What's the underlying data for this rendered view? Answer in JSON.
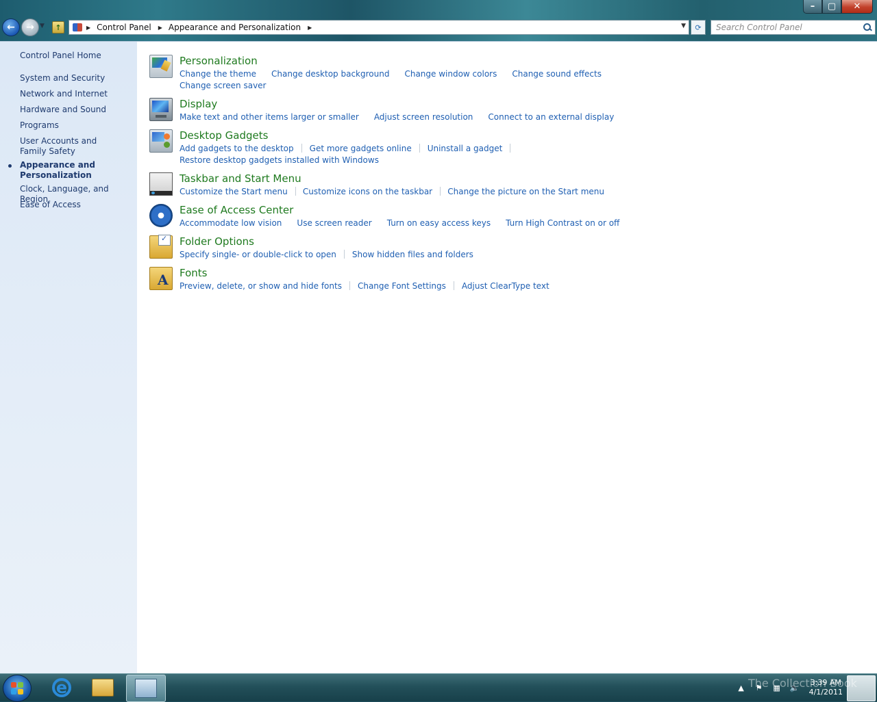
{
  "window": {
    "buttons": {
      "minimize": "–",
      "maximize": "▢",
      "close": "✕"
    }
  },
  "nav": {
    "back_glyph": "←",
    "forward_glyph": "→",
    "refresh_glyph": "⟳"
  },
  "address": {
    "crumbs": [
      "Control Panel",
      "Appearance and Personalization"
    ]
  },
  "search": {
    "placeholder": "Search Control Panel"
  },
  "sidebar": {
    "items": [
      {
        "label": "Control Panel Home"
      },
      {
        "label": "System and Security"
      },
      {
        "label": "Network and Internet"
      },
      {
        "label": "Hardware and Sound"
      },
      {
        "label": "Programs"
      },
      {
        "label": "User Accounts and Family Safety"
      },
      {
        "label": "Appearance and Personalization",
        "active": true
      },
      {
        "label": "Clock, Language, and Region"
      },
      {
        "label": "Ease of Access"
      }
    ]
  },
  "categories": [
    {
      "title": "Personalization",
      "icon": "personalization-icon",
      "lines": [
        [
          "Change the theme",
          "Change desktop background",
          "Change window colors",
          "Change sound effects"
        ],
        [
          "Change screen saver"
        ]
      ]
    },
    {
      "title": "Display",
      "icon": "display-icon",
      "lines": [
        [
          "Make text and other items larger or smaller",
          "Adjust screen resolution",
          "Connect to an external display"
        ]
      ]
    },
    {
      "title": "Desktop Gadgets",
      "icon": "desktop-gadgets-icon",
      "lines": [
        [
          "Add gadgets to the desktop",
          "Get more gadgets online",
          "Uninstall a gadget"
        ],
        [
          "Restore desktop gadgets installed with Windows"
        ]
      ]
    },
    {
      "title": "Taskbar and Start Menu",
      "icon": "taskbar-icon",
      "lines": [
        [
          "Customize the Start menu",
          "Customize icons on the taskbar",
          "Change the picture on the Start menu"
        ]
      ]
    },
    {
      "title": "Ease of Access Center",
      "icon": "ease-of-access-icon",
      "lines": [
        [
          "Accommodate low vision",
          "Use screen reader",
          "Turn on easy access keys",
          "Turn High Contrast on or off"
        ]
      ]
    },
    {
      "title": "Folder Options",
      "icon": "folder-options-icon",
      "lines": [
        [
          "Specify single- or double-click to open",
          "Show hidden files and folders"
        ]
      ]
    },
    {
      "title": "Fonts",
      "icon": "fonts-icon",
      "lines": [
        [
          "Preview, delete, or show and hide fonts",
          "Change Font Settings",
          "Adjust ClearType text"
        ]
      ]
    }
  ],
  "taskbar": {
    "clock_time": "3:39 AM",
    "clock_date": "4/1/2011",
    "watermark": "The Collection Book"
  },
  "colors": {
    "title_green": "#1f7a1f",
    "link_blue": "#1f5fb2",
    "sidebar_bg": "#dce8f6"
  }
}
